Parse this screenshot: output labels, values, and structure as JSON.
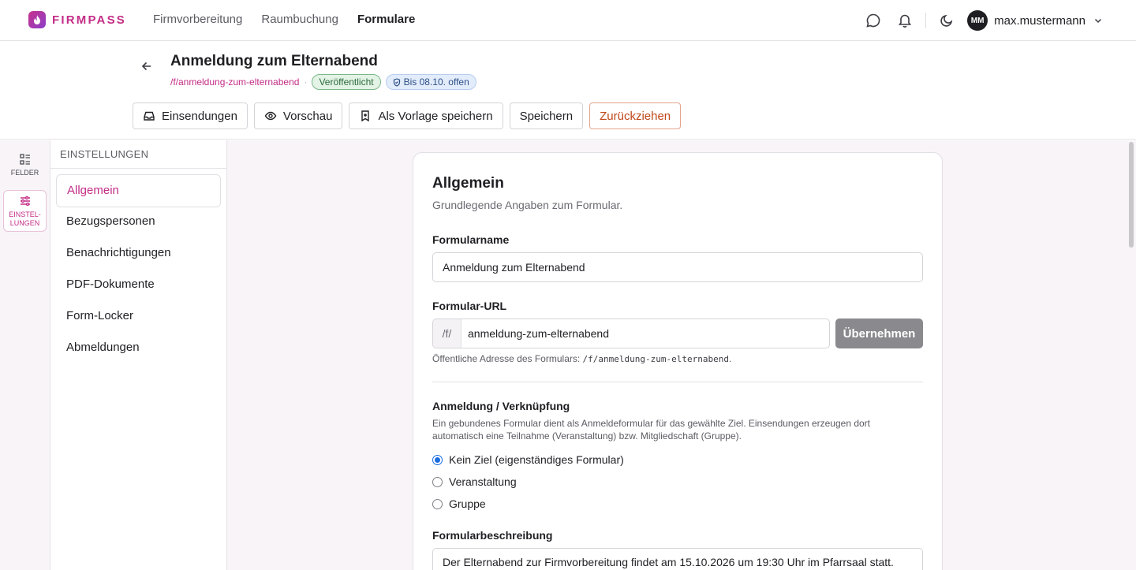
{
  "app": {
    "brand": "FIRMPASS",
    "nav": [
      "Firmvorbereitung",
      "Raumbuchung",
      "Formulare"
    ],
    "active_nav": "Formulare",
    "user": {
      "initials": "MM",
      "name": "max.mustermann"
    }
  },
  "header": {
    "title": "Anmeldung zum Elternabend",
    "slug": "/f/anmeldung-zum-elternabend",
    "separator": "·",
    "status_badge": "Veröffentlicht",
    "deadline_badge": "Bis 08.10. offen",
    "toolbar": {
      "submissions": "Einsendungen",
      "preview": "Vorschau",
      "save_template": "Als Vorlage speichern",
      "save": "Speichern",
      "withdraw": "Zurückziehen"
    }
  },
  "rail": {
    "fields_label": "FELDER",
    "settings_label_1": "EINSTEL-",
    "settings_label_2": "LUNGEN"
  },
  "settings_nav": {
    "heading": "EINSTELLUNGEN",
    "items": [
      "Allgemein",
      "Bezugspersonen",
      "Benachrichtigungen",
      "PDF-Dokumente",
      "Form-Locker",
      "Abmeldungen"
    ],
    "active": "Allgemein"
  },
  "card": {
    "title": "Allgemein",
    "subtitle": "Grundlegende Angaben zum Formular.",
    "form_name_label": "Formularname",
    "form_name_value": "Anmeldung zum Elternabend",
    "url_label": "Formular-URL",
    "url_prefix": "/f/",
    "url_value": "anmeldung-zum-elternabend",
    "apply_label": "Übernehmen",
    "url_hint_prefix": "Öffentliche Adresse des Formulars: ",
    "url_hint_code": "/f/anmeldung-zum-elternabend",
    "url_hint_suffix": ".",
    "link_label": "Anmeldung / Verknüpfung",
    "link_help": "Ein gebundenes Formular dient als Anmeldeformular für das gewählte Ziel. Einsendungen erzeugen dort automatisch eine Teilnahme (Veranstaltung) bzw. Mitgliedschaft (Gruppe).",
    "link_options": [
      "Kein Ziel (eigenständiges Formular)",
      "Veranstaltung",
      "Gruppe"
    ],
    "link_selected": "Kein Ziel (eigenständiges Formular)",
    "description_label": "Formularbeschreibung",
    "description_value": "Der Elternabend zur Firmvorbereitung findet am 15.10.2026 um 19:30 Uhr im Pfarrsaal statt."
  },
  "colors": {
    "brand": "#c32d86",
    "radio_active": "#1a6de0",
    "danger": "#c0471a"
  }
}
